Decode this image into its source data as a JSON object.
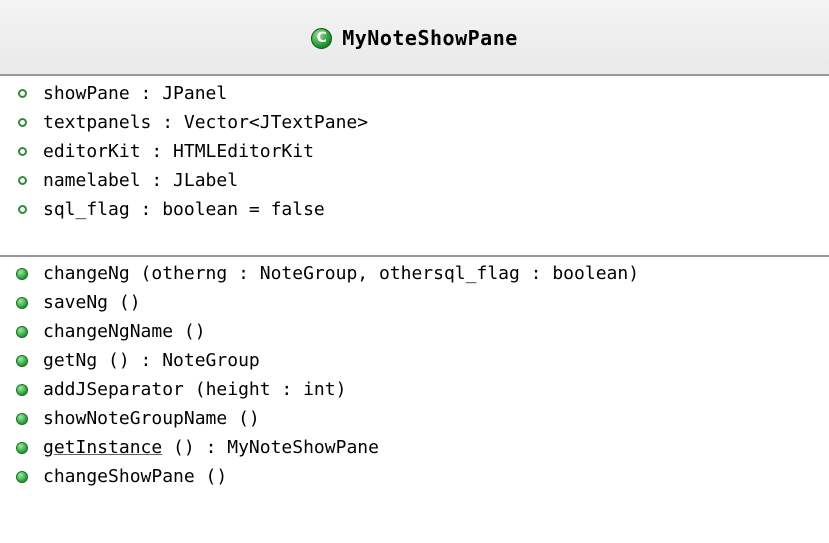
{
  "class_box": {
    "icon_letter": "C",
    "name": "MyNoteShowPane"
  },
  "attributes": [
    "showPane : JPanel",
    "textpanels : Vector<JTextPane>",
    "editorKit : HTMLEditorKit",
    "namelabel : JLabel",
    "sql_flag : boolean = false"
  ],
  "operations": [
    {
      "name": "changeNg",
      "rest": " (otherng : NoteGroup, othersql_flag : boolean)"
    },
    {
      "name": "saveNg",
      "rest": " ()"
    },
    {
      "name": "changeNgName",
      "rest": " ()"
    },
    {
      "name": "getNg",
      "rest": " () : NoteGroup"
    },
    {
      "name": "addJSeparator",
      "rest": " (height : int)"
    },
    {
      "name": "showNoteGroupName",
      "rest": " ()"
    },
    {
      "name": "getInstance",
      "rest": " () : MyNoteShowPane"
    },
    {
      "name": "changeShowPane",
      "rest": " ()"
    }
  ],
  "icons": {
    "class": "class-icon",
    "attribute": "field-icon",
    "operation": "method-icon"
  },
  "colors": {
    "icon_green": "#2ca13c",
    "header_bg": "#eeeeee",
    "divider": "#9a9a9a"
  }
}
